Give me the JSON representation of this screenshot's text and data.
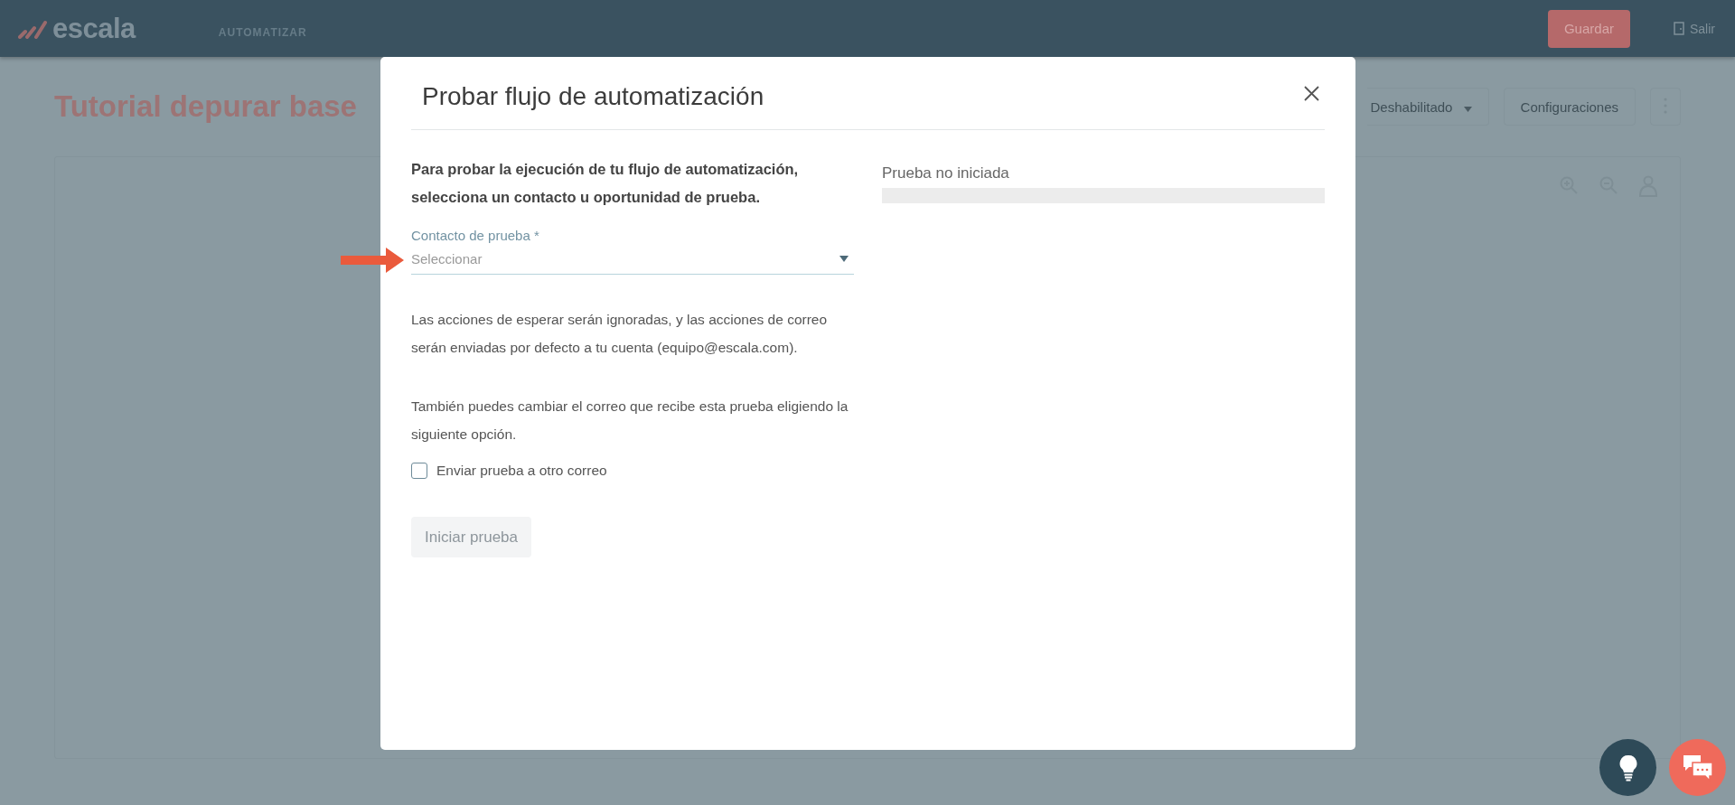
{
  "header": {
    "logo": "escala",
    "section": "AUTOMATIZAR",
    "save_button": "Guardar",
    "exit_link": "Salir"
  },
  "page": {
    "title": "Tutorial depurar base",
    "status_dropdown": "Deshabilitado",
    "settings_button": "Configuraciones"
  },
  "modal": {
    "title": "Probar flujo de automatización",
    "intro": "Para probar la ejecución de tu flujo de automatización, selecciona un contacto u oportunidad de prueba.",
    "contact_field": {
      "label": "Contacto de prueba *",
      "placeholder": "Seleccionar"
    },
    "notes": [
      "Las acciones de esperar serán ignoradas, y las acciones de correo serán enviadas por defecto a tu cuenta (equipo@escala.com).",
      "También puedes cambiar el correo que recibe esta prueba eligiendo la siguiente opción."
    ],
    "checkbox": {
      "label": "Enviar prueba a otro correo",
      "checked": false
    },
    "start_button": {
      "label": "Iniciar prueba",
      "disabled": true
    },
    "status": {
      "label": "Prueba no iniciada",
      "level": 0
    }
  }
}
